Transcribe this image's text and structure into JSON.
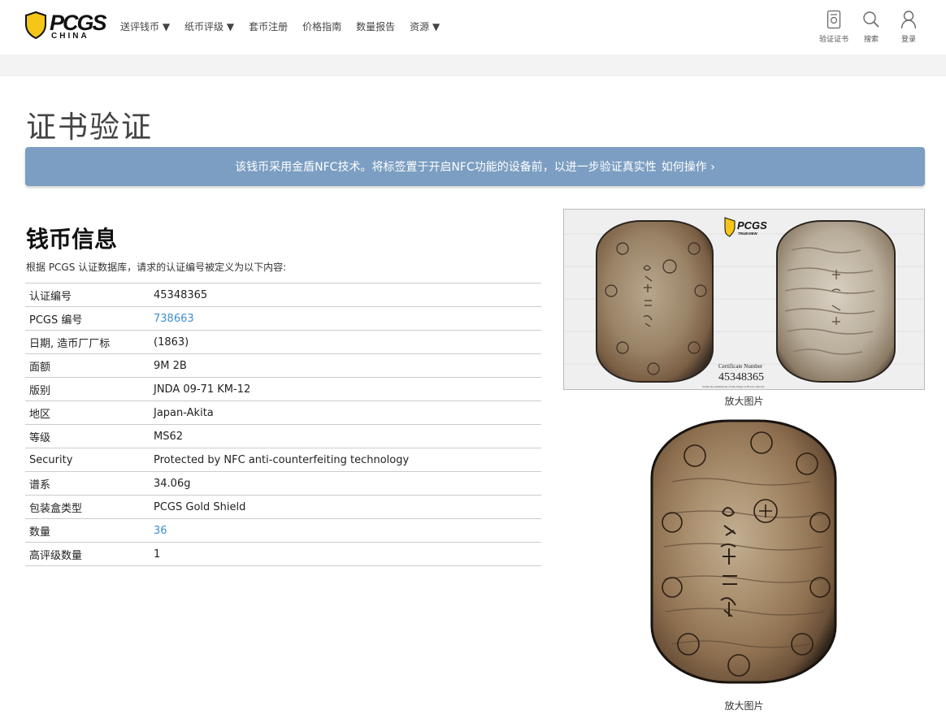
{
  "header": {
    "logo_text": "PCGS",
    "logo_sub": "CHINA",
    "nav": [
      {
        "label": "送评钱币 ▼"
      },
      {
        "label": "纸币评级 ▼"
      },
      {
        "label": "套币注册"
      },
      {
        "label": "价格指南"
      },
      {
        "label": "数量报告"
      },
      {
        "label": "资源 ▼"
      }
    ],
    "tools": [
      {
        "label": "验证证书",
        "icon": "certificate-icon"
      },
      {
        "label": "搜索",
        "icon": "search-icon"
      },
      {
        "label": "登录",
        "icon": "user-icon"
      }
    ]
  },
  "page": {
    "title": "证书验证",
    "nfc_text": "该钱币采用金盾NFC技术。将标签置于开启NFC功能的设备前，以进一步验证真实性",
    "nfc_link": "如何操作 ›",
    "banner_color": "#7b9ec2"
  },
  "coin_info": {
    "title": "钱币信息",
    "intro": "根据 PCGS 认证数据库，请求的认证编号被定义为以下内容:",
    "rows": [
      {
        "key": "认证编号",
        "value": "45348365"
      },
      {
        "key": "PCGS 编号",
        "value": "738663"
      },
      {
        "key": "日期, 造币厂厂标",
        "value": "(1863)"
      },
      {
        "key": "面额",
        "value": "9M 2B"
      },
      {
        "key": "版别",
        "value": "JNDA 09-71 KM-12"
      },
      {
        "key": "地区",
        "value": "Japan-Akita"
      },
      {
        "key": "等级",
        "value": "MS62"
      },
      {
        "key": "Security",
        "value": "Protected by NFC anti-counterfeiting technology"
      },
      {
        "key": "谱系",
        "value": "34.06g"
      },
      {
        "key": "包装盒类型",
        "value": "PCGS Gold Shield"
      },
      {
        "key": "数量",
        "value": "36"
      },
      {
        "key": "高评级数量",
        "value": "1"
      }
    ]
  },
  "images": {
    "slab_logo": "PCGS",
    "slab_logo_sub": "TRUEVIEW",
    "slab_cert_label": "Certificate Number",
    "slab_cert_number": "45348365",
    "slab_verify_text": "Verify the authenticity of this image at PCGS.com/cert",
    "caption1": "放大图片",
    "caption2": "放大图片"
  }
}
